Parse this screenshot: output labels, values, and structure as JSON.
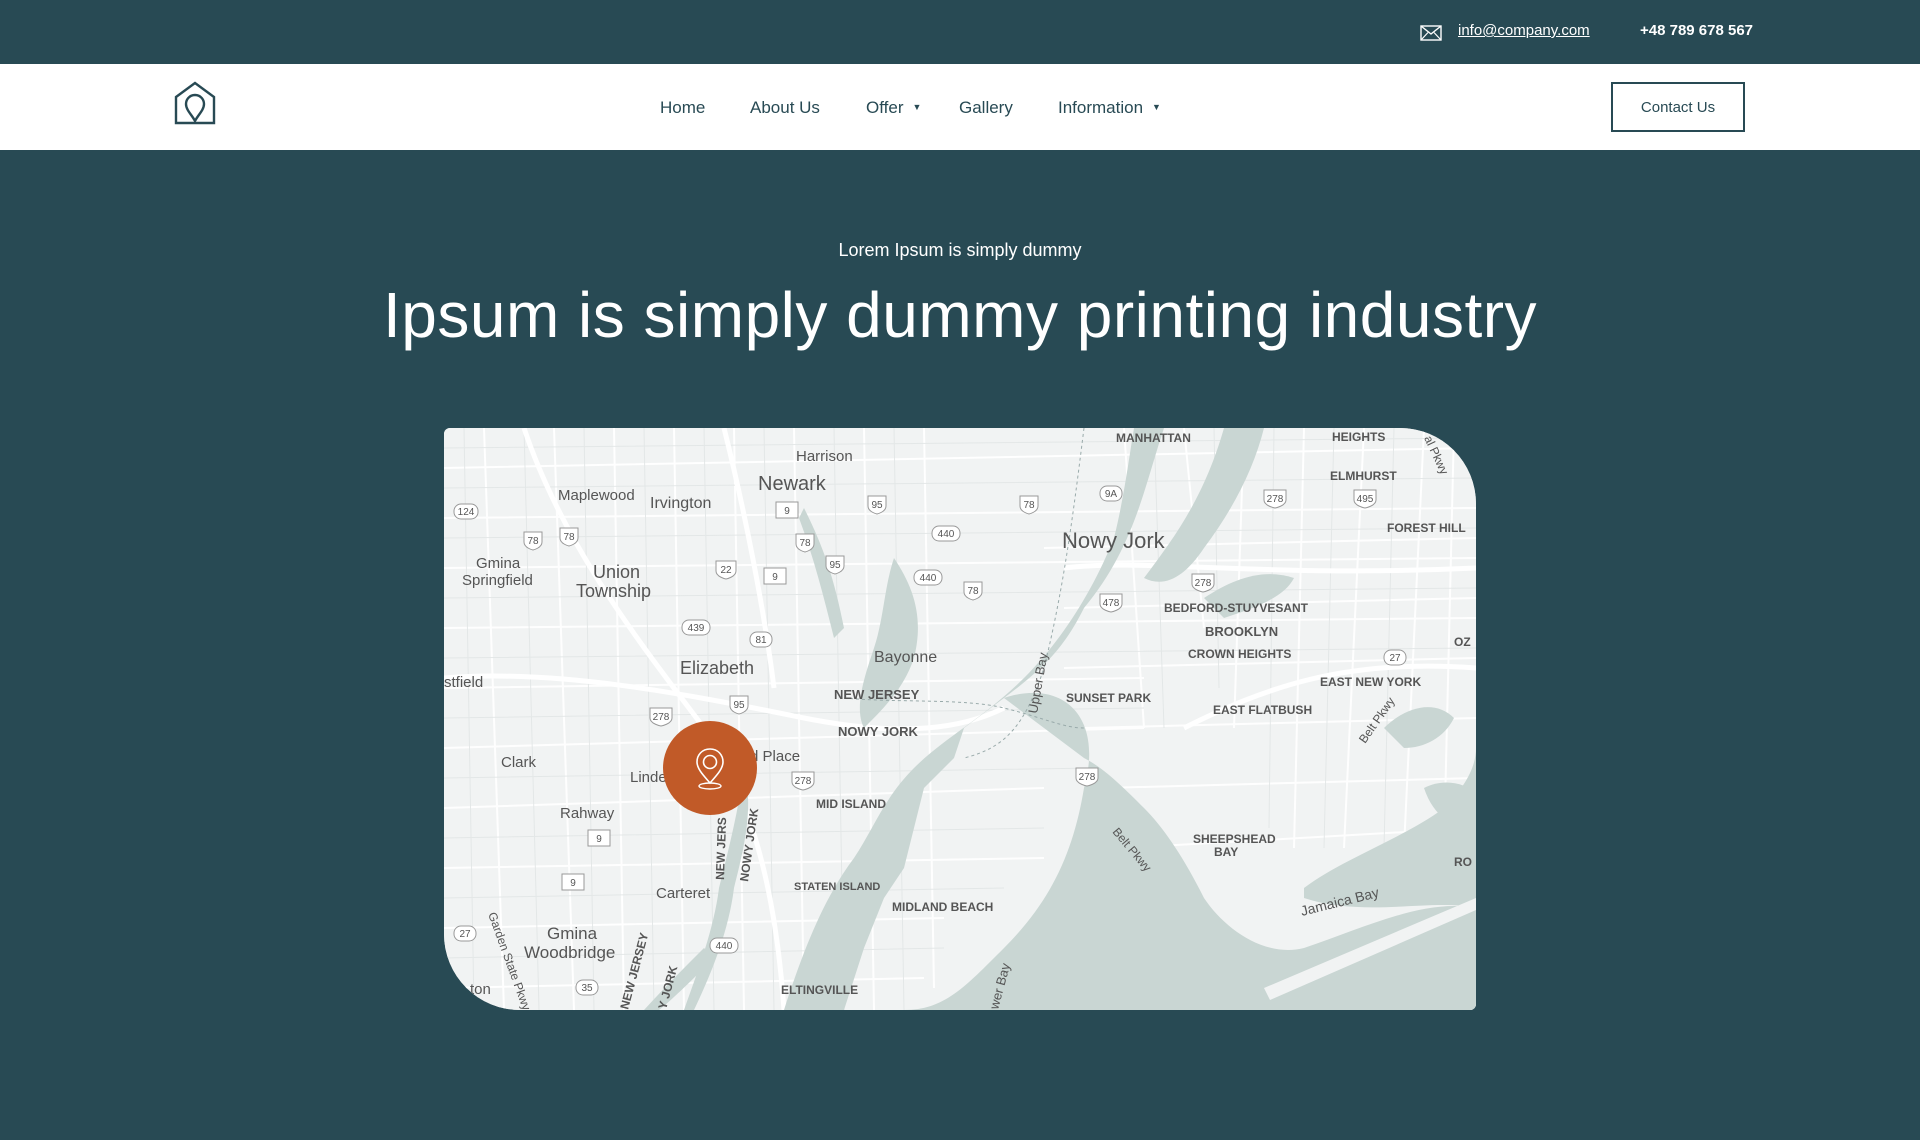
{
  "topbar": {
    "email": "info@company.com",
    "phone": "+48 789 678 567",
    "email_icon": "mail-icon"
  },
  "navbar": {
    "logo_icon": "house-location-logo",
    "items": [
      {
        "label": "Home",
        "has_dropdown": false
      },
      {
        "label": "About Us",
        "has_dropdown": false
      },
      {
        "label": "Offer",
        "has_dropdown": true
      },
      {
        "label": "Gallery",
        "has_dropdown": false
      },
      {
        "label": "Information",
        "has_dropdown": true
      }
    ],
    "dropdown_caret": "▼",
    "contact_label": "Contact Us"
  },
  "hero": {
    "subtitle": "Lorem Ipsum is simply dummy",
    "title": "Ipsum is simply dummy printing industry"
  },
  "map": {
    "marker_icon": "location-pin-icon",
    "marker_color": "#c15a28",
    "labels": {
      "newark": "Newark",
      "harrison": "Harrison",
      "maplewood": "Maplewood",
      "irvington": "Irvington",
      "gmina_springfield_1": "Gmina",
      "gmina_springfield_2": "Springfield",
      "union_1": "Union",
      "union_2": "Township",
      "elizabeth": "Elizabeth",
      "bayonne": "Bayonne",
      "new_jersey": "NEW JERSEY",
      "nowy_jork_small": "NOWY JORK",
      "westfield": "stfield",
      "clark": "Clark",
      "linden": "Linde",
      "place": "d Place",
      "rahway": "Rahway",
      "mid_island": "MID ISLAND",
      "staten_island": "STATEN ISLAND",
      "carteret": "Carteret",
      "midland_beach": "MIDLAND BEACH",
      "gmina_woodbridge_1": "Gmina",
      "gmina_woodbridge_2": "Woodbridge",
      "eltingville": "ELTINGVILLE",
      "nowy_jork_big": "Nowy Jork",
      "upper_bay": "Upper Bay",
      "bedford": "BEDFORD-STUYVESANT",
      "brooklyn": "BROOKLYN",
      "crown_heights": "CROWN HEIGHTS",
      "sunset_park": "SUNSET PARK",
      "east_flatbush": "EAST FLATBUSH",
      "east_new_york": "EAST NEW YORK",
      "sheepshead_1": "SHEEPSHEAD",
      "sheepshead_2": "BAY",
      "jamaica_bay": "Jamaica Bay",
      "elmhurst": "ELMHURST",
      "forest_hill": "FOREST HILL",
      "heights": "HEIGHTS",
      "midtown": "MANHATTAN",
      "belt_pkwy": "Belt Pkwy",
      "belt_pkwy2": "Belt Pkwy",
      "oz": "OZ",
      "ro": "RO",
      "garden_state": "Garden State Pkwy",
      "new_jersey_vert": "NEW JERS",
      "nowy_jork_vert": "NOWY JORK",
      "ton": "ton",
      "lower_bay": "wer Bay",
      "new_jersey_bottom": "NEW JERSEY",
      "y_jork_bottom": "Y JORK",
      "al_pkwy": "al Pkwy"
    },
    "shields": [
      "124",
      "78",
      "78",
      "22",
      "9",
      "95",
      "95",
      "78",
      "9",
      "440",
      "440",
      "78",
      "9A",
      "78",
      "278",
      "495",
      "278",
      "478",
      "439",
      "81",
      "95",
      "278",
      "278",
      "27",
      "278",
      "9",
      "9",
      "27",
      "35",
      "440"
    ]
  }
}
